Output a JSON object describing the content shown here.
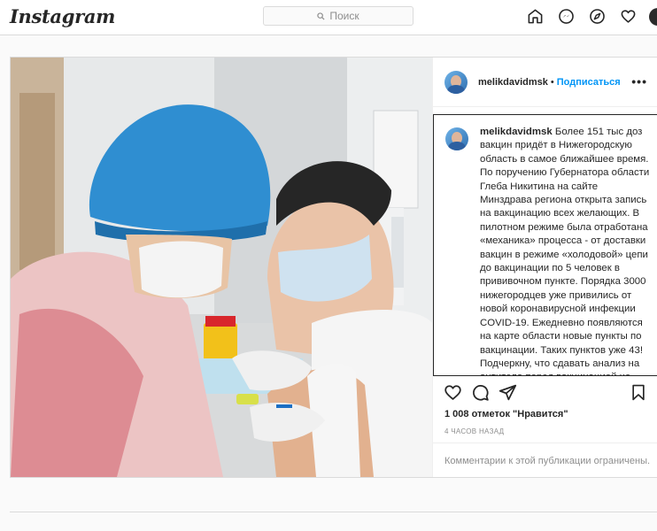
{
  "header": {
    "logo": "Instagram",
    "search_placeholder": "Поиск"
  },
  "nav": {
    "icons": [
      "home-icon",
      "messenger-icon",
      "explore-icon",
      "heart-icon",
      "profile-avatar"
    ]
  },
  "post": {
    "username": "melikdavidmsk",
    "separator": "•",
    "follow_label": "Подписаться",
    "more_label": "•••",
    "caption_user": "melikdavidmsk",
    "caption_text": "Более 151 тыс доз вакцин придёт в Нижегородскую область в самое ближайшее время. По поручению Губернатора области Глеба Никитина на сайте Минздрава региона открыта запись на вакцинацию всех желающих. В пилотном режиме была отработана «механика» процесса - от доставки вакцин в режиме «холодовой» цепи до вакцинации по 5 человек в прививочном пункте. Порядка 3000 нижегородцев уже привились от новой коронавирусной инфекции COVID-19. Ежедневно появляются на карте области новые пункты по вакцинации. Таких пунктов уже 43! Подчеркну, что сдавать анализ на антитела перед вакцинацией не требуется. Минздрав России дал",
    "likes": "1 008 отметок \"Нравится\"",
    "time": "4 ЧАСОВ НАЗАД",
    "comments_disabled": "Комментарии к этой публикации ограничены."
  },
  "colors": {
    "accent": "#0095f6",
    "text": "#262626",
    "muted": "#8e8e8e",
    "border": "#dbdbdb"
  }
}
